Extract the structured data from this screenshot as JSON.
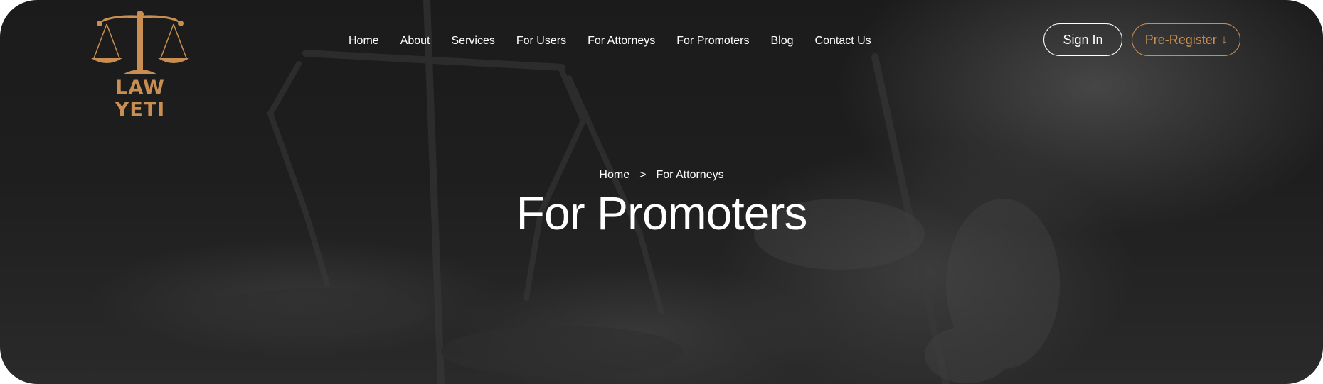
{
  "brand": {
    "name": "LAW YETI",
    "accent_color": "#c98f52",
    "logo_icon": "scales-of-justice-icon"
  },
  "nav": {
    "items": [
      {
        "label": "Home"
      },
      {
        "label": "About"
      },
      {
        "label": "Services"
      },
      {
        "label": "For Users"
      },
      {
        "label": "For Attorneys"
      },
      {
        "label": "For Promoters"
      },
      {
        "label": "Blog"
      },
      {
        "label": "Contact Us"
      }
    ]
  },
  "actions": {
    "sign_in_label": "Sign In",
    "pre_register_label": "Pre-Register",
    "pre_register_icon": "arrow-down-icon",
    "pre_register_arrow": "↓"
  },
  "breadcrumb": {
    "home": "Home",
    "separator": ">",
    "current": "For Attorneys"
  },
  "page": {
    "title": "For Promoters"
  }
}
